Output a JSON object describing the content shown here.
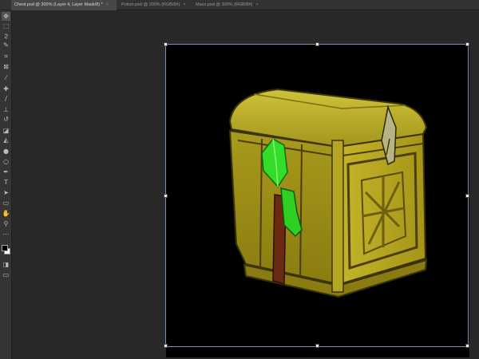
{
  "tabs": [
    {
      "label": "Chest.psd @ 300% (Layer 4, Layer Mask/8) *",
      "close": "×",
      "active": true
    },
    {
      "label": "Potion.psd @ 300% (RGB/8#)",
      "close": "×",
      "active": false
    },
    {
      "label": "Mace.psd @ 300% (RGB/8#)",
      "close": "×",
      "active": false
    }
  ],
  "tools": [
    {
      "name": "move-tool",
      "glyph": "✥"
    },
    {
      "name": "marquee-tool",
      "glyph": "⬚"
    },
    {
      "name": "lasso-tool",
      "glyph": "ϩ"
    },
    {
      "name": "quick-select-tool",
      "glyph": "✎"
    },
    {
      "name": "crop-tool",
      "glyph": "⌗"
    },
    {
      "name": "frame-tool",
      "glyph": "⊠"
    },
    {
      "name": "eyedropper-tool",
      "glyph": "⁄"
    },
    {
      "name": "healing-brush-tool",
      "glyph": "✚"
    },
    {
      "name": "brush-tool",
      "glyph": "∕"
    },
    {
      "name": "clone-stamp-tool",
      "glyph": "⊥"
    },
    {
      "name": "history-brush-tool",
      "glyph": "↺"
    },
    {
      "name": "eraser-tool",
      "glyph": "◪"
    },
    {
      "name": "paint-bucket-tool",
      "glyph": "◭"
    },
    {
      "name": "blur-tool",
      "glyph": "●"
    },
    {
      "name": "dodge-tool",
      "glyph": "○"
    },
    {
      "name": "pen-tool",
      "glyph": "✒"
    },
    {
      "name": "type-tool",
      "glyph": "T"
    },
    {
      "name": "path-selection-tool",
      "glyph": "➤"
    },
    {
      "name": "rectangle-tool",
      "glyph": "▭"
    },
    {
      "name": "hand-tool",
      "glyph": "✋"
    },
    {
      "name": "zoom-tool",
      "glyph": "⚲"
    },
    {
      "name": "more-tools",
      "glyph": "⋯"
    }
  ],
  "colors": {
    "foreground": "#000000",
    "background": "#ffffff",
    "chest_body": "#a89a1e",
    "chest_highlight": "#d8cc3a",
    "chest_shadow": "#5a4f0c",
    "gem": "#32d92a",
    "strap": "#6a2a10"
  },
  "icons": {
    "quick_mask": "◨",
    "screen_mode": "▭"
  }
}
